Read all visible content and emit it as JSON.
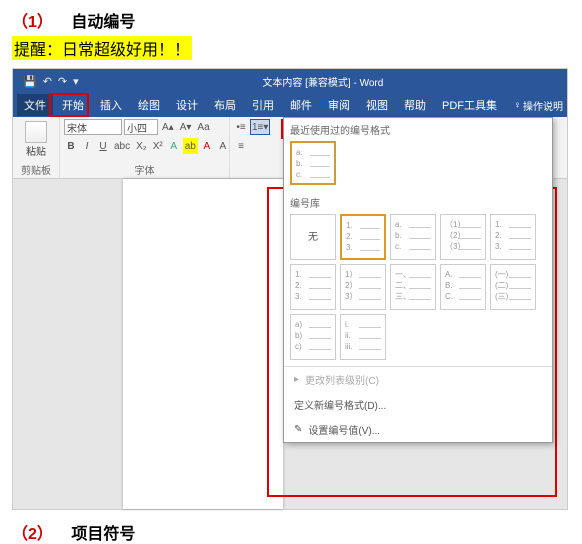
{
  "heading1": {
    "num": "（1）",
    "text": "自动编号"
  },
  "reminder": "提醒：日常超级好用！！",
  "titlebar": {
    "title": "文本内容 [兼容模式] - Word"
  },
  "menu": {
    "file": "文件",
    "home": "开始",
    "insert": "插入",
    "draw": "绘图",
    "design": "设计",
    "layout": "布局",
    "references": "引用",
    "mailings": "邮件",
    "review": "审阅",
    "view": "视图",
    "help": "帮助",
    "pdf": "PDF工具集",
    "tellme_icon": "♀",
    "tellme": "操作说明"
  },
  "ribbon": {
    "paste": "粘贴",
    "clipboard_label": "剪贴板",
    "font_name": "宋体",
    "font_size": "小四",
    "font_label": "字体"
  },
  "dropdown": {
    "recent_label": "最近使用过的编号格式",
    "library_label": "编号库",
    "none": "无",
    "formats": {
      "r0": [
        "a.",
        "b.",
        "c."
      ],
      "l0": [
        "1.",
        "2.",
        "3."
      ],
      "l1": [
        "a.",
        "b.",
        "c."
      ],
      "l2": [
        "（1）",
        "（2）",
        "（3）"
      ],
      "l3": [
        "1.",
        "2.",
        "3."
      ],
      "l4": [
        "1.",
        "2.",
        "3."
      ],
      "l5": [
        "1）",
        "2）",
        "3）"
      ],
      "l6": [
        "一、",
        "二、",
        "三、"
      ],
      "l7": [
        "A.",
        "B.",
        "C."
      ],
      "l8": [
        "(一)",
        "(二)",
        "(三)"
      ],
      "l9": [
        "a)",
        "b)",
        "c)"
      ],
      "l10": [
        "i.",
        "ii.",
        "iii."
      ]
    },
    "footer": {
      "change_level": "更改列表级别(C)",
      "define_new": "定义新编号格式(D)...",
      "set_value": "设置编号值(V)..."
    }
  },
  "heading2": {
    "num": "（2）",
    "text": "项目符号"
  }
}
